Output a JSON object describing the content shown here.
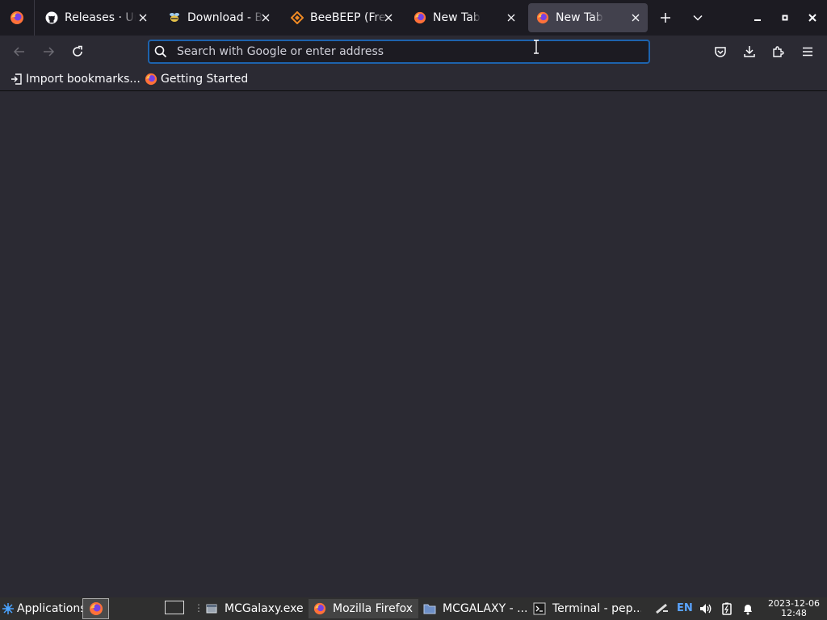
{
  "tabs": [
    {
      "title": "Releases · Uni",
      "icon": "github-icon",
      "active": false
    },
    {
      "title": "Download - Be",
      "icon": "beebeep-icon",
      "active": false
    },
    {
      "title": "BeeBEEP (Free",
      "icon": "beebeep-diamond-icon",
      "active": false
    },
    {
      "title": "New Tab",
      "icon": "firefox-icon",
      "active": false
    },
    {
      "title": "New Tab",
      "icon": "firefox-icon",
      "active": true
    }
  ],
  "urlbar": {
    "placeholder": "Search with Google or enter address",
    "value": ""
  },
  "bookmarks": [
    {
      "label": "Import bookmarks...",
      "icon": "import-icon"
    },
    {
      "label": "Getting Started",
      "icon": "firefox-icon"
    }
  ],
  "taskbar": {
    "apps_menu_label": "Applications",
    "tasks": [
      {
        "label": "MCGalaxy.exe",
        "icon": "window-icon",
        "active": false
      },
      {
        "label": "Mozilla Firefox",
        "icon": "firefox-icon",
        "active": true
      },
      {
        "label": "MCGALAXY - ...",
        "icon": "folder-icon",
        "active": false
      },
      {
        "label": "Terminal - pep...",
        "icon": "terminal-icon",
        "active": false
      }
    ],
    "keyboard_layout": "EN",
    "clock_date": "2023-12-06",
    "clock_time": "12:48"
  },
  "colors": {
    "tabstrip_bg": "#1c1b22",
    "toolbar_bg": "#2b2a33",
    "active_tab_bg": "#42414d",
    "urlbar_focus": "#1d63ad",
    "taskbar_bg": "#2f2f2f"
  }
}
